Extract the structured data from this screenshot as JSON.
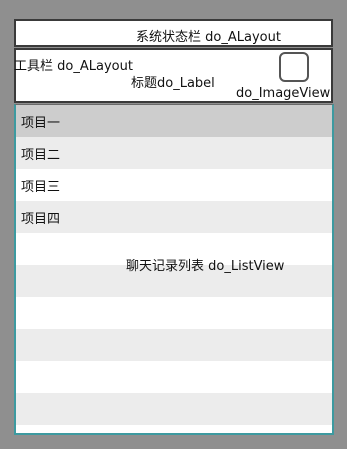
{
  "status_bar": {
    "label": "系统状态栏 do_ALayout"
  },
  "toolbar": {
    "label": "工具栏 do_ALayout",
    "title_label": "标题do_Label",
    "image_label": "do_ImageView"
  },
  "list_view": {
    "label": "聊天记录列表 do_ListView",
    "items": [
      {
        "label": "项目一",
        "selected": true
      },
      {
        "label": "项目二",
        "selected": false
      },
      {
        "label": "项目三",
        "selected": false
      },
      {
        "label": "项目四",
        "selected": false
      }
    ]
  },
  "colors": {
    "page_background": "#8f8f8f",
    "row_selected": "#cdcdcd",
    "row_stripe": "#ececec",
    "row_plain": "#ffffff",
    "list_border": "#3d9aa0"
  }
}
